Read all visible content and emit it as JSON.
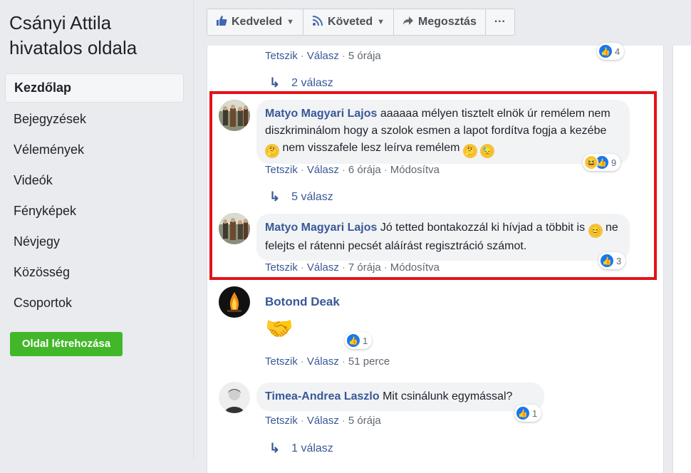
{
  "sidebar": {
    "title": "Csányi Attila hivatalos oldala",
    "items": [
      {
        "label": "Kezdőlap",
        "active": true
      },
      {
        "label": "Bejegyzések"
      },
      {
        "label": "Vélemények"
      },
      {
        "label": "Videók"
      },
      {
        "label": "Fényképek"
      },
      {
        "label": "Névjegy"
      },
      {
        "label": "Közösség"
      },
      {
        "label": "Csoportok"
      }
    ],
    "create_button": "Oldal létrehozása"
  },
  "actionbar": {
    "like": "Kedveled",
    "follow": "Követed",
    "share": "Megosztás",
    "more": "···"
  },
  "actions": {
    "like": "Tetszik",
    "reply": "Válasz",
    "edited": "Módosítva"
  },
  "top_comment": {
    "time": "5 órája",
    "reactions": "4",
    "replies": "2 válasz"
  },
  "comments": [
    {
      "author": "Matyo Magyari Lajos",
      "text_1": "aaaaaa mélyen tisztelt elnök úr remélem nem diszkriminálom hogy a szolok esmen a lapot fordítva fogja a kezébe",
      "text_2": "nem visszafele lesz leírva remélem",
      "time": "6 órája",
      "reactions": "9",
      "replies": "5 válasz"
    },
    {
      "author": "Matyo Magyari Lajos",
      "text_1": "Jó tetted bontakozzál ki hívjad a többit is",
      "text_2": "ne felejts el rátenni pecsét aláírást regisztráció számot.",
      "time": "7 órája",
      "reactions": "3"
    },
    {
      "author": "Botond Deak",
      "emoji": "🤝",
      "time": "51 perce",
      "reactions": "1"
    },
    {
      "author": "Timea-Andrea Laszlo",
      "text": "Mit csinálunk egymással?",
      "time": "5 órája",
      "reactions": "1",
      "replies": "1 válasz"
    }
  ],
  "colors": {
    "highlight": "#e3121a",
    "link": "#385898",
    "create_button": "#42b72a"
  }
}
